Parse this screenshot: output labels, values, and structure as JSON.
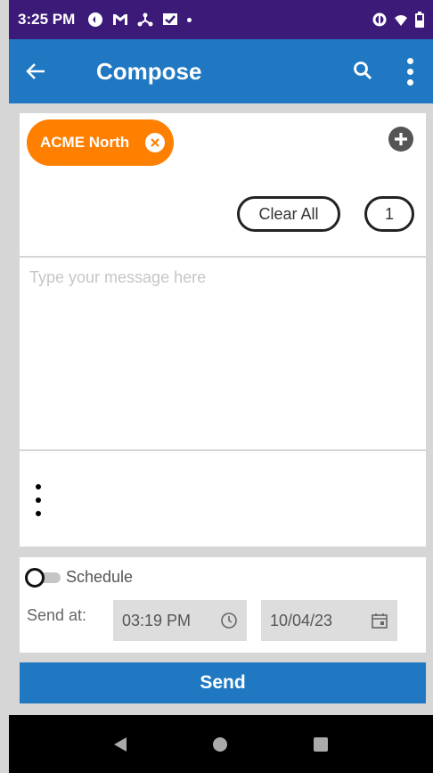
{
  "status_bar": {
    "time": "3:25 PM",
    "left_icons": [
      "notification-icon",
      "gmail-icon",
      "network-icon",
      "message-icon",
      "dot-icon"
    ],
    "right_icons": [
      "data-saver-icon",
      "wifi-icon",
      "battery-icon"
    ]
  },
  "app_bar": {
    "title": "Compose",
    "back_icon": "arrow-left-icon",
    "search_icon": "search-icon",
    "more_icon": "more-vertical-icon",
    "color": "#1f78c1"
  },
  "recipients": {
    "chips": [
      {
        "label": "ACME North",
        "color": "#ff7f00"
      }
    ],
    "add_icon": "plus-circle-icon",
    "clear_all_label": "Clear All",
    "count": "1"
  },
  "message": {
    "placeholder": "Type your message here",
    "value": ""
  },
  "options": {
    "menu_icon": "more-vertical-icon"
  },
  "schedule": {
    "label": "Schedule",
    "enabled": false,
    "send_at_label": "Send at:",
    "time_value": "03:19 PM",
    "time_icon": "clock-icon",
    "date_value": "10/04/23",
    "date_icon": "calendar-icon"
  },
  "send_button": {
    "label": "Send"
  },
  "nav_bar": {
    "items": [
      "nav-back-icon",
      "nav-home-icon",
      "nav-recents-icon"
    ]
  }
}
